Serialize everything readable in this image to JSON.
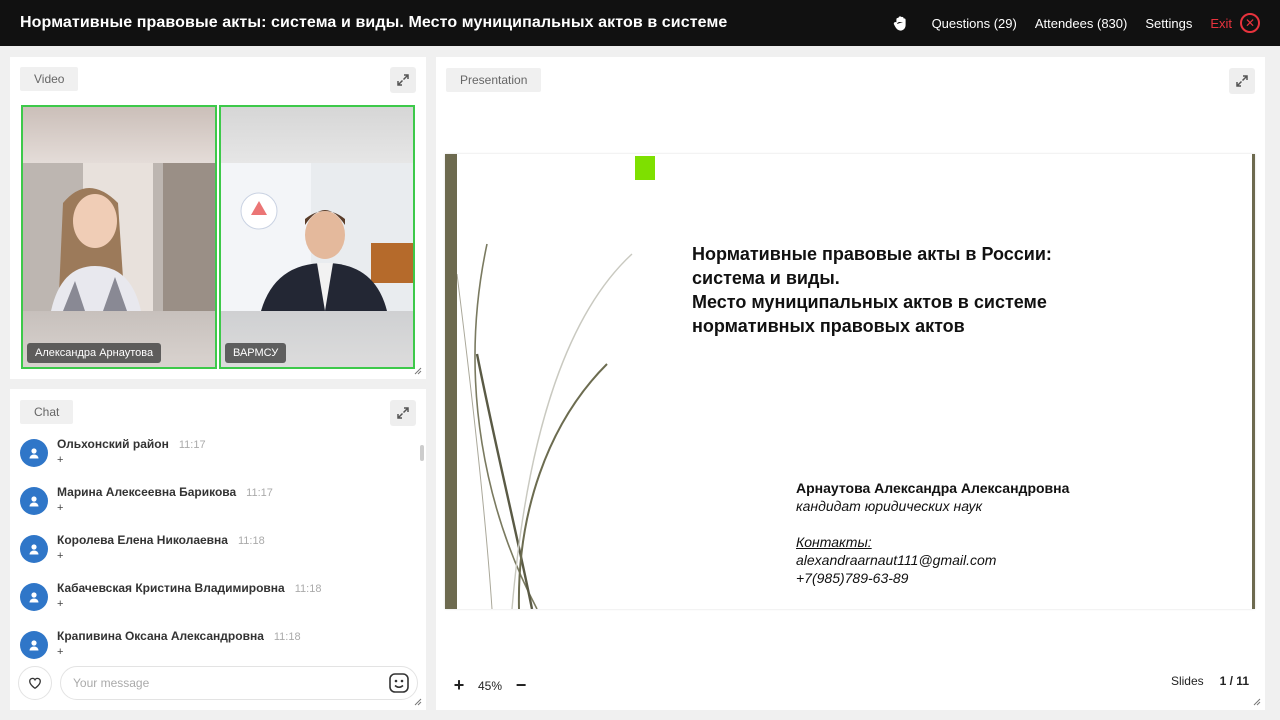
{
  "topbar": {
    "title": "Нормативные правовые акты: система и виды. Место муниципальных актов в системе",
    "questions": "Questions (29)",
    "attendees": "Attendees (830)",
    "settings": "Settings",
    "exit": "Exit"
  },
  "video": {
    "label": "Video",
    "tiles": [
      {
        "name": "Александра Арнаутова"
      },
      {
        "name": "ВАРМСУ"
      }
    ]
  },
  "chat": {
    "label": "Chat",
    "messages": [
      {
        "author": "Ольхонский район",
        "time": "11:17",
        "text": "+"
      },
      {
        "author": "Марина Алексеевна Барикова",
        "time": "11:17",
        "text": "+"
      },
      {
        "author": "Королева Елена Николаевна",
        "time": "11:18",
        "text": "+"
      },
      {
        "author": "Кабачевская Кристина Владимировна",
        "time": "11:18",
        "text": "+"
      },
      {
        "author": "Крапивина Оксана Александровна",
        "time": "11:18",
        "text": "+"
      }
    ],
    "input_placeholder": "Your message"
  },
  "presentation": {
    "label": "Presentation",
    "slide": {
      "title_lines": [
        "Нормативные правовые акты в России:",
        "система и виды.",
        "Место муниципальных актов в системе",
        "нормативных правовых актов"
      ],
      "author": "Арнаутова Александра Александровна",
      "degree": "кандидат юридических наук",
      "contacts_label": "Контакты:",
      "email": "alexandraarnaut111@gmail.com",
      "phone": "+7(985)789-63-89"
    },
    "zoom": "45%",
    "slides_label": "Slides",
    "slide_counter": "1 / 11"
  },
  "colors": {
    "accent_green": "#3dc94a",
    "exit_red": "#e8333d",
    "avatar_blue": "#2f76c8",
    "slide_bar": "#6d6a4f"
  }
}
